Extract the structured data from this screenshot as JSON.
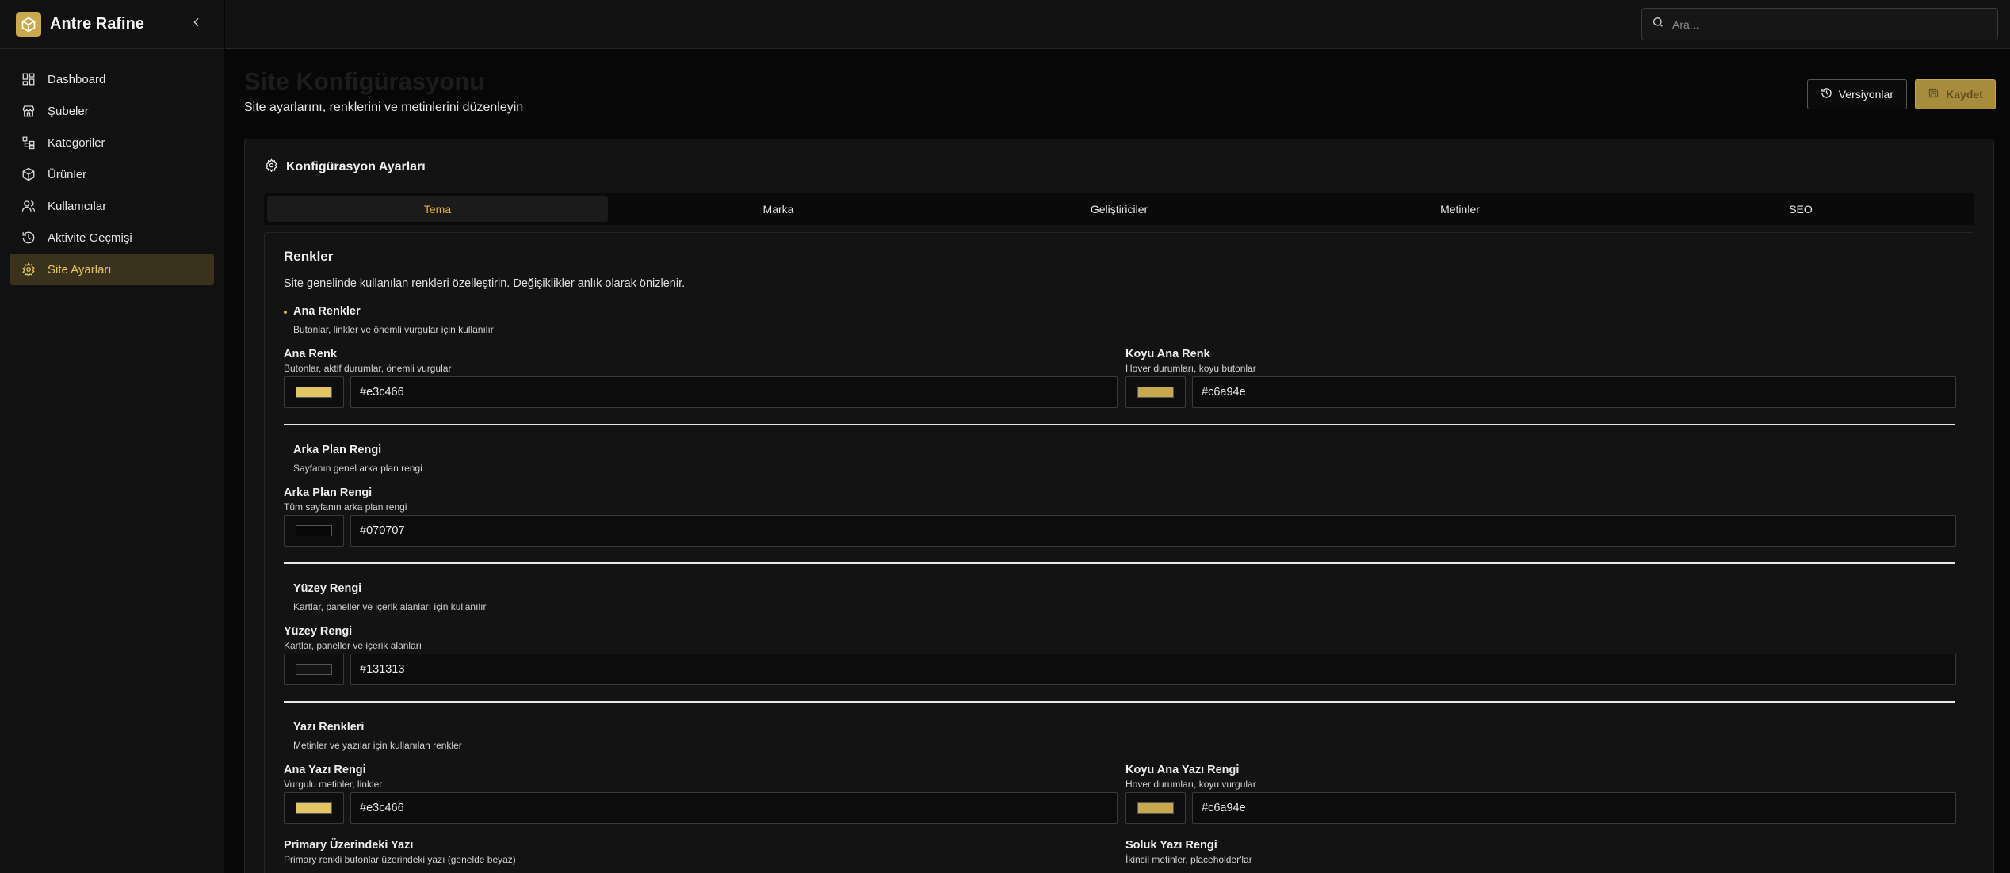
{
  "app": {
    "name": "Antre Rafine"
  },
  "colors": {
    "accent": "#e3c466",
    "accent_dark": "#c6a94e",
    "background": "#070707",
    "surface": "#131313"
  },
  "sidebar": {
    "items": [
      {
        "label": "Dashboard",
        "icon": "dashboard-icon"
      },
      {
        "label": "Şubeler",
        "icon": "store-icon"
      },
      {
        "label": "Kategoriler",
        "icon": "category-tree-icon"
      },
      {
        "label": "Ürünler",
        "icon": "box-icon"
      },
      {
        "label": "Kullanıcılar",
        "icon": "users-icon"
      },
      {
        "label": "Aktivite Geçmişi",
        "icon": "history-icon"
      },
      {
        "label": "Site Ayarları",
        "icon": "gear-icon",
        "active": true
      }
    ]
  },
  "search": {
    "placeholder": "Ara..."
  },
  "page": {
    "title": "Site Konfigürasyonu",
    "subtitle": "Site ayarlarını, renklerini ve metinlerini düzenleyin",
    "versions_label": "Versiyonlar",
    "save_label": "Kaydet"
  },
  "card": {
    "title": "Konfigürasyon Ayarları",
    "tabs": [
      {
        "label": "Tema",
        "active": true
      },
      {
        "label": "Marka"
      },
      {
        "label": "Geliştiriciler"
      },
      {
        "label": "Metinler"
      },
      {
        "label": "SEO"
      }
    ]
  },
  "colors_section": {
    "title": "Renkler",
    "desc": "Site genelinde kullanılan renkleri özelleştirin. Değişiklikler anlık olarak önizlenir.",
    "groups": {
      "main": {
        "title": "Ana Renkler",
        "desc": "Butonlar, linkler ve önemli vurgular için kullanılır",
        "fields": [
          {
            "label": "Ana Renk",
            "hint": "Butonlar, aktif durumlar, önemli vurgular",
            "value": "#e3c466"
          },
          {
            "label": "Koyu Ana Renk",
            "hint": "Hover durumları, koyu butonlar",
            "value": "#c6a94e"
          }
        ]
      },
      "background": {
        "title": "Arka Plan Rengi",
        "desc": "Sayfanın genel arka plan rengi",
        "fields": [
          {
            "label": "Arka Plan Rengi",
            "hint": "Tüm sayfanın arka plan rengi",
            "value": "#070707"
          }
        ]
      },
      "surface": {
        "title": "Yüzey Rengi",
        "desc": "Kartlar, paneller ve içerik alanları için kullanılır",
        "fields": [
          {
            "label": "Yüzey Rengi",
            "hint": "Kartlar, paneller ve içerik alanları",
            "value": "#131313"
          }
        ]
      },
      "text": {
        "title": "Yazı Renkleri",
        "desc": "Metinler ve yazılar için kullanılan renkler",
        "fields": [
          {
            "label": "Ana Yazı Rengi",
            "hint": "Vurgulu metinler, linkler",
            "value": "#e3c466"
          },
          {
            "label": "Koyu Ana Yazı Rengi",
            "hint": "Hover durumları, koyu vurgular",
            "value": "#c6a94e"
          },
          {
            "label": "Primary Üzerindeki Yazı",
            "hint": "Primary renkli butonlar üzerindeki yazı (genelde beyaz)"
          },
          {
            "label": "Soluk Yazı Rengi",
            "hint": "İkincil metinler, placeholder'lar"
          }
        ]
      }
    }
  }
}
